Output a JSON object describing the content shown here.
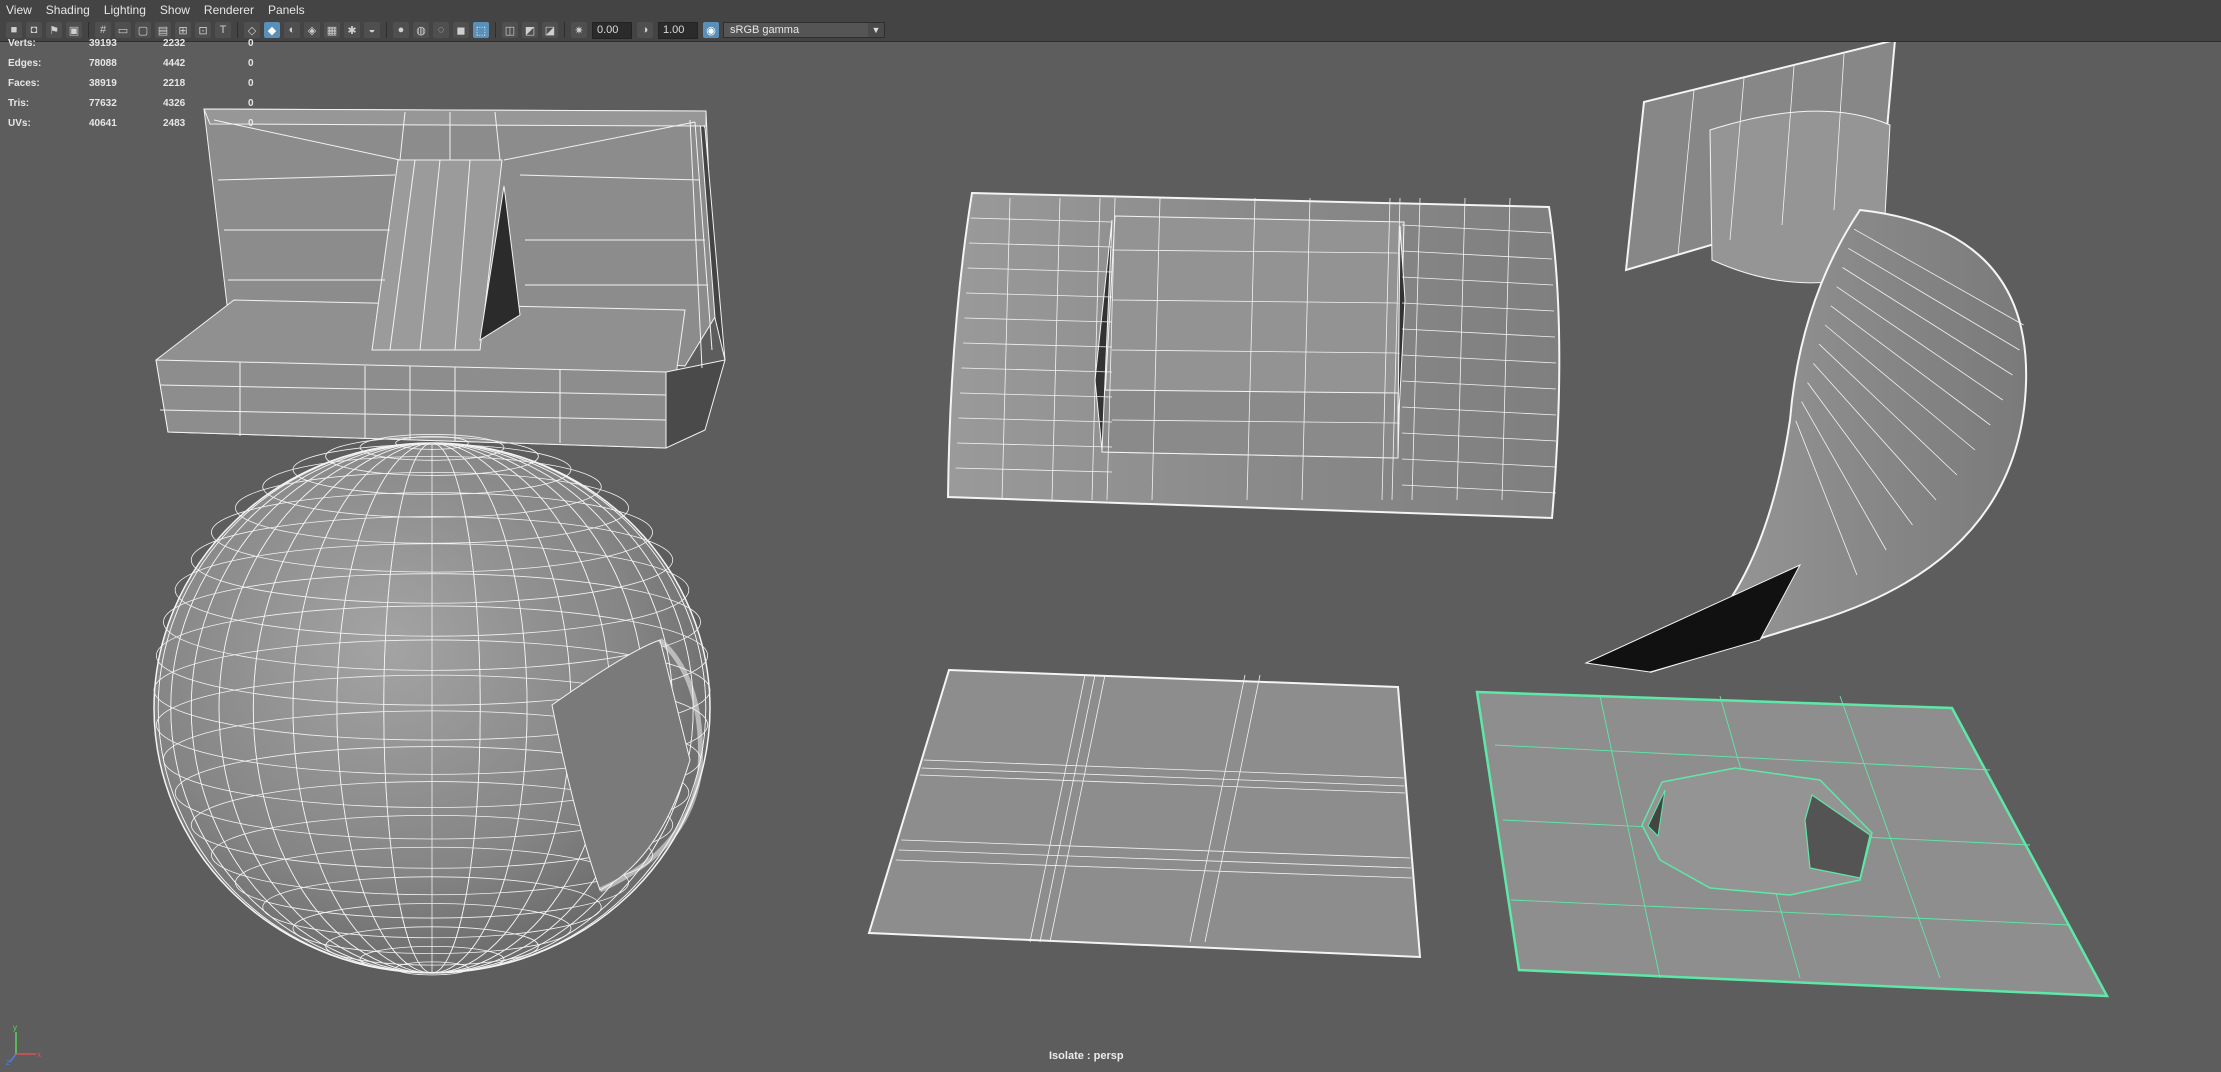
{
  "menubar": {
    "items": [
      {
        "label": "View"
      },
      {
        "label": "Shading"
      },
      {
        "label": "Lighting"
      },
      {
        "label": "Show"
      },
      {
        "label": "Renderer"
      },
      {
        "label": "Panels"
      }
    ]
  },
  "toolbar": {
    "exposure": "0.00",
    "gamma": "1.00",
    "color_space": "sRGB gamma"
  },
  "hud": {
    "rows": [
      {
        "label": "Verts:",
        "scene": "39193",
        "selected": "2232",
        "third": "0"
      },
      {
        "label": "Edges:",
        "scene": "78088",
        "selected": "4442",
        "third": "0"
      },
      {
        "label": "Faces:",
        "scene": "38919",
        "selected": "2218",
        "third": "0"
      },
      {
        "label": "Tris:",
        "scene": "77632",
        "selected": "4326",
        "third": "0"
      },
      {
        "label": "UVs:",
        "scene": "40641",
        "selected": "2483",
        "third": "0"
      }
    ]
  },
  "viewport": {
    "label": "Isolate : persp",
    "selection_color": "#5ee8a8",
    "background_color": "#5d5d5d",
    "face_color": "#8a8a8a",
    "wire_color": "#ffffff"
  },
  "axis": {
    "x": "x",
    "y": "y",
    "z": "z"
  }
}
